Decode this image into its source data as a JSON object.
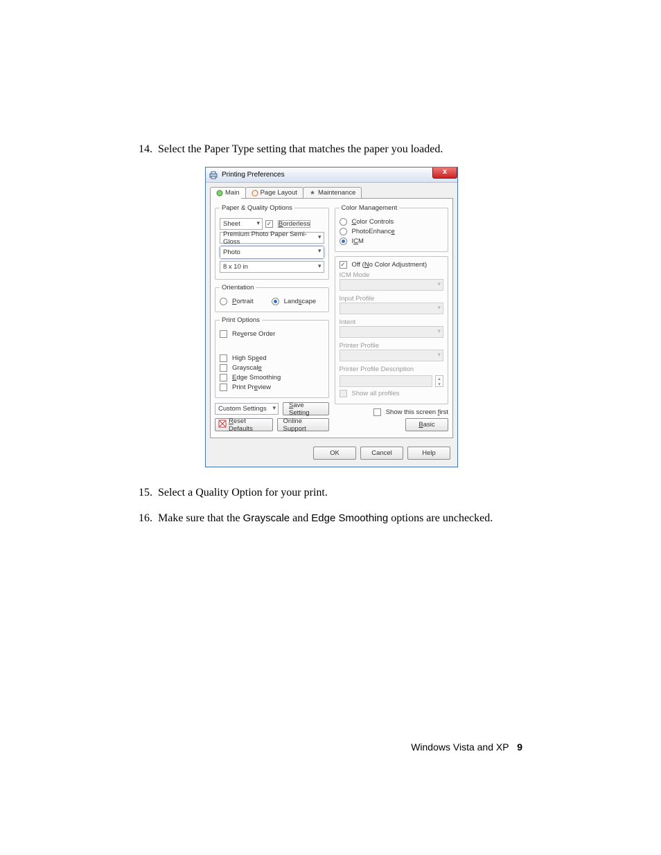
{
  "step14": "Select the Paper Type setting that matches the paper you loaded.",
  "step15": "Select a Quality Option for your print.",
  "step16_a": "Make sure that the ",
  "step16_b": " and ",
  "step16_c": " options are unchecked.",
  "step16_gray": "Grayscale",
  "step16_edge": "Edge Smoothing",
  "footer_text": "Windows Vista and XP",
  "footer_page": "9",
  "dlg": {
    "title": "Printing Preferences",
    "close": "x",
    "tabs": {
      "main": "Main",
      "layout": "Page Layout",
      "maint": "Maintenance"
    },
    "paper": {
      "legend": "Paper & Quality Options",
      "source": "Sheet",
      "borderless": "Borderless",
      "type": "Premium Photo Paper Semi-Gloss",
      "quality": "Photo",
      "size": "8 x 10 in"
    },
    "orient": {
      "legend": "Orientation",
      "portrait": "Portrait",
      "landscape": "Landscape"
    },
    "print": {
      "legend": "Print Options",
      "reverse": "Reverse Order",
      "highspeed": "High Speed",
      "gray": "Grayscale",
      "edge": "Edge Smoothing",
      "preview": "Print Preview"
    },
    "custom": "Custom Settings",
    "save": "Save Setting",
    "reset": "Reset Defaults",
    "online": "Online Support",
    "color": {
      "legend": "Color Management",
      "controls": "Color Controls",
      "photo": "PhotoEnhance",
      "icm": "ICM",
      "off": "Off (No Color Adjustment)",
      "mode": "ICM Mode",
      "input": "Input Profile",
      "intent": "Intent",
      "printer": "Printer Profile",
      "desc": "Printer Profile Description",
      "showall": "Show all profiles",
      "showfirst": "Show this screen first",
      "basic": "Basic"
    },
    "ok": "OK",
    "cancel": "Cancel",
    "help": "Help"
  }
}
